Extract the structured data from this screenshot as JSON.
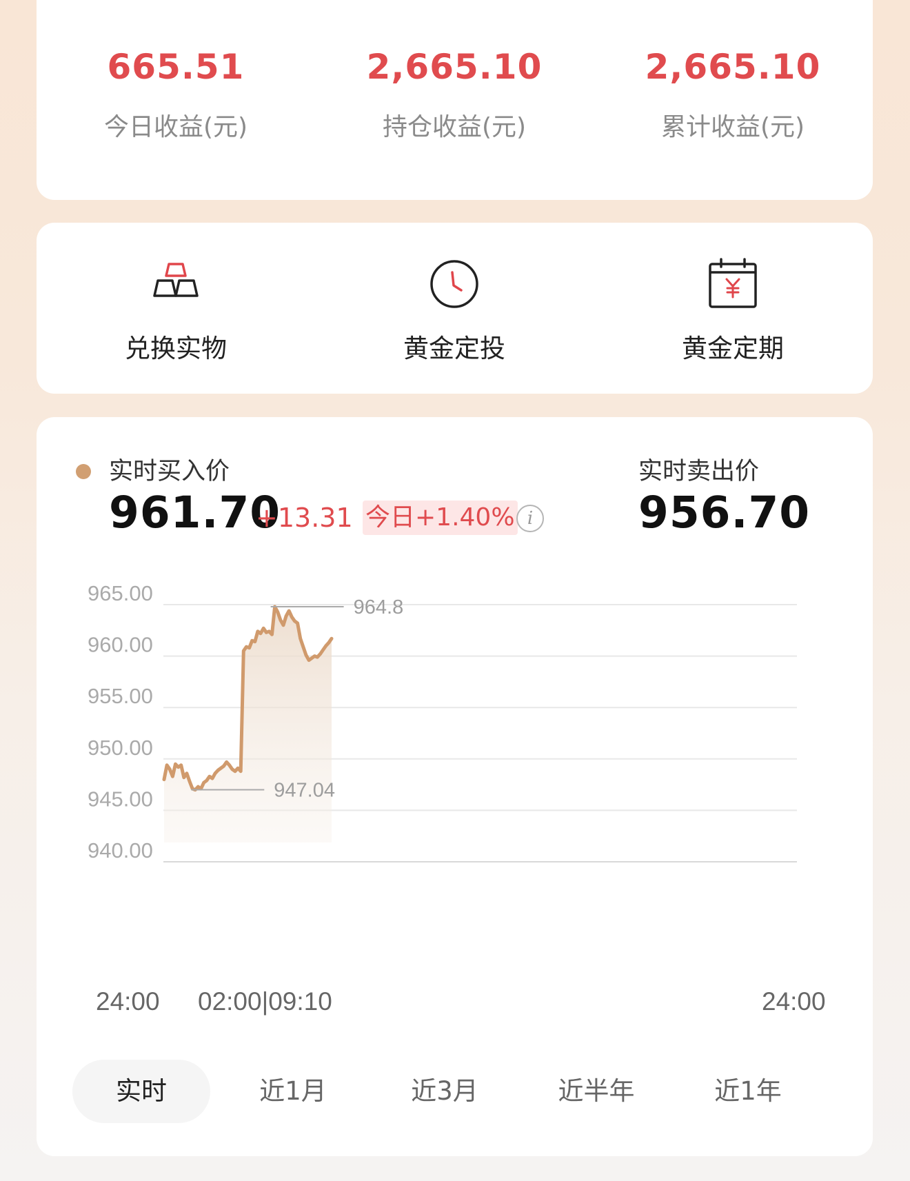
{
  "stats": [
    {
      "value": "665.51",
      "label": "今日收益(元)"
    },
    {
      "value": "2,665.10",
      "label": "持仓收益(元)"
    },
    {
      "value": "2,665.10",
      "label": "累计收益(元)"
    }
  ],
  "shortcuts": [
    {
      "label": "兑换实物",
      "icon": "gold-bars-icon"
    },
    {
      "label": "黄金定投",
      "icon": "clock-icon"
    },
    {
      "label": "黄金定期",
      "icon": "calendar-yen-icon"
    }
  ],
  "quote": {
    "buy_label": "实时买入价",
    "buy_price": "961.70",
    "change": "+13.31",
    "change_pct": "今日+1.40%",
    "info_glyph": "i",
    "sell_label": "实时卖出价",
    "sell_price": "956.70"
  },
  "chart_data": {
    "type": "line",
    "yticks": [
      "965.00",
      "960.00",
      "955.00",
      "950.00",
      "945.00",
      "940.00"
    ],
    "ylim": [
      940,
      965
    ],
    "xticks": [
      "24:00",
      "02:00|09:10",
      "24:00"
    ],
    "annotations": {
      "max": "964.8",
      "min": "947.04"
    },
    "series": [
      {
        "values": [
          948.0,
          949.4,
          949.0,
          948.3,
          949.5,
          949.2,
          949.4,
          948.2,
          948.6,
          947.8,
          947.1,
          947.0,
          947.3,
          947.1,
          947.7,
          947.9,
          948.3,
          948.1,
          948.6,
          948.9,
          949.1,
          949.3,
          949.7,
          949.4,
          949.0,
          948.8,
          949.1,
          948.8,
          960.5,
          960.9,
          960.8,
          961.5,
          961.4,
          962.4,
          962.2,
          962.7,
          962.3,
          962.4,
          962.1,
          964.8,
          964.3,
          963.5,
          963.0,
          963.9,
          964.4,
          963.8,
          963.4,
          963.2,
          961.7,
          960.9,
          960.1,
          959.6,
          959.8,
          960.0,
          959.9,
          960.2,
          960.6,
          961.0,
          961.3,
          961.7
        ]
      }
    ],
    "grid": true
  },
  "range_tabs": [
    {
      "label": "实时",
      "active": true
    },
    {
      "label": "近1月",
      "active": false
    },
    {
      "label": "近3月",
      "active": false
    },
    {
      "label": "近半年",
      "active": false
    },
    {
      "label": "近1年",
      "active": false
    }
  ],
  "colors": {
    "accent_red": "#e04b4e",
    "gold_line": "#d09a6c",
    "dot": "#d19f72"
  }
}
